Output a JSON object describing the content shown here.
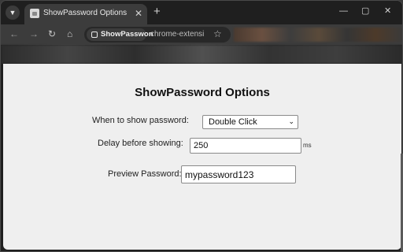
{
  "browser": {
    "tab_title": "ShowPassword Options",
    "tab_close": "✕",
    "new_tab": "+",
    "chip_label": "ShowPasswon",
    "url_text": "chrome-extensi",
    "window_controls": {
      "dropdown": "⌄",
      "minimize": "—",
      "maximize": "▢",
      "close": "✕"
    }
  },
  "page": {
    "title": "ShowPassword Options",
    "when_label": "When to show password:",
    "when_value": "Double Click",
    "when_options": [
      "Double Click"
    ],
    "delay_label": "Delay before showing:",
    "delay_value": "250",
    "delay_unit": "ms",
    "preview_label": "Preview Password:",
    "preview_value": "mypassword123"
  }
}
